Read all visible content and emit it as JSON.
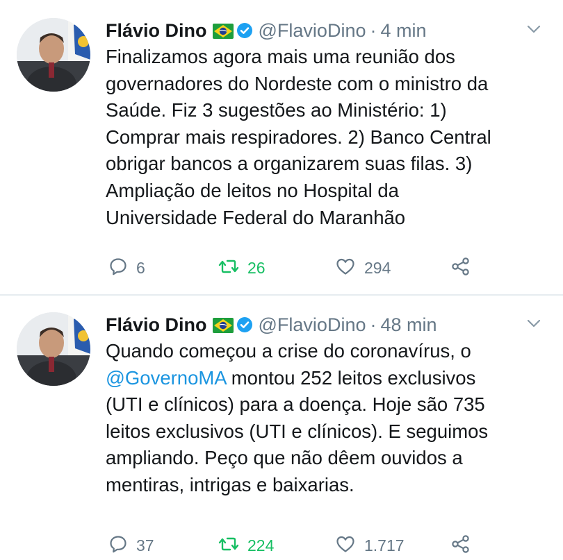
{
  "tweets": [
    {
      "author": "Flávio Dino",
      "handle": "@FlavioDino",
      "separator": "·",
      "time": "4 min",
      "lines": [
        "Finalizamos agora mais uma reunião dos",
        "governadores do Nordeste com o ministro da",
        "Saúde. Fiz 3 sugestões ao Ministério: 1)",
        "Comprar mais respiradores. 2) Banco Central",
        "obrigar bancos a organizarem suas filas. 3)",
        "Ampliação de leitos no Hospital da",
        "Universidade Federal do Maranhão"
      ],
      "replies": "6",
      "retweets": "26",
      "likes": "294"
    },
    {
      "author": "Flávio Dino",
      "handle": "@FlavioDino",
      "separator": "·",
      "time": "48 min",
      "line1": "Quando começou a crise do coronavírus, o",
      "mention": "@GovernoMA",
      "line2_rest": " montou 252 leitos exclusivos",
      "lines": [
        "(UTI e clínicos) para a doença. Hoje são 735",
        "leitos exclusivos (UTI e clínicos). E seguimos",
        "ampliando. Peço que não dêem ouvidos a",
        "mentiras, intrigas e baixarias."
      ],
      "replies": "37",
      "retweets": "224",
      "likes": "1.717"
    }
  ],
  "colors": {
    "text": "#14171a",
    "muted": "#657786",
    "link": "#1b95e0",
    "retweet_green": "#17bf63",
    "verified_blue": "#1da1f2",
    "divider": "#e6ecf0"
  },
  "icons": {
    "reply": "reply-icon",
    "retweet": "retweet-icon",
    "like": "heart-icon",
    "share": "share-icon",
    "caret": "chevron-down-icon",
    "verified": "verified-badge-icon",
    "flag": "brazil-flag-icon"
  }
}
